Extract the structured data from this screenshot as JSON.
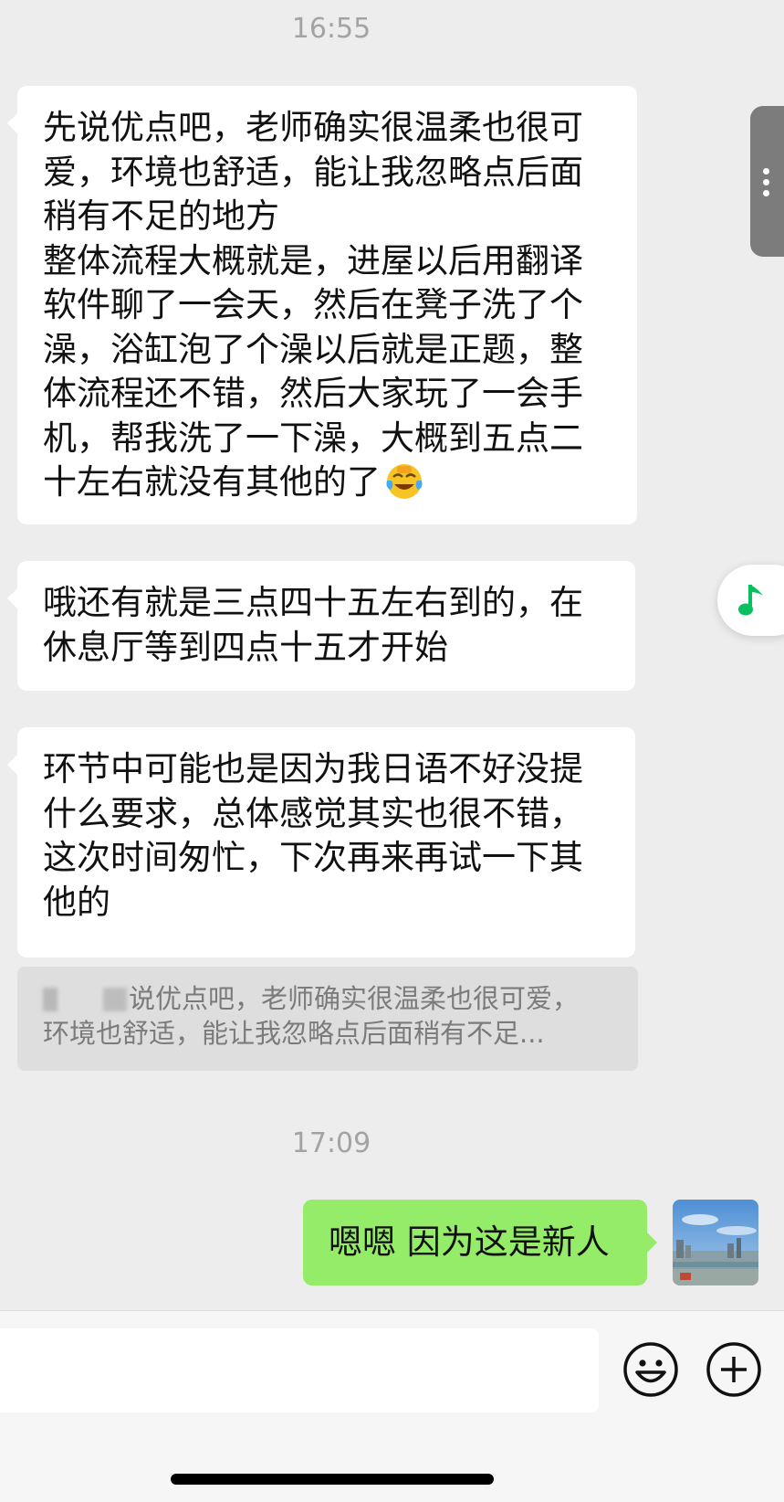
{
  "messages": [
    {
      "type": "time",
      "text": "16:55"
    },
    {
      "type": "incoming",
      "lines": [
        "先说优点吧，老师确实很温柔也很可",
        "爱，环境也舒适，能让我忽略点后面",
        "稍有不足的地方",
        "整体流程大概就是，进屋以后用翻译",
        "软件聊了一会天，然后在凳子洗了个",
        "澡，浴缸泡了个澡以后就是正题，整",
        "体流程还不错，然后大家玩了一会手",
        "机，帮我洗了一下澡，大概到五点二",
        "十左右就没有其他的了"
      ],
      "emoji": "face-with-tears-of-joy"
    },
    {
      "type": "incoming",
      "lines": [
        "哦还有就是三点四十五左右到的，在",
        "休息厅等到四点十五才开始"
      ]
    },
    {
      "type": "incoming",
      "lines": [
        "环节中可能也是因为我日语不好没提",
        "什么要求，总体感觉其实也很不错，",
        "这次时间匆忙，下次再来再试一下其",
        "他的"
      ]
    },
    {
      "type": "quote",
      "lines": [
        "说优点吧，老师确实很温柔也很可爱，",
        "环境也舒适，能让我忽略点后面稍有不足..."
      ]
    },
    {
      "type": "time",
      "text": "17:09"
    },
    {
      "type": "outgoing",
      "text": "嗯嗯 因为这是新人"
    }
  ],
  "icons": {
    "side_handle": "more-dots-icon",
    "floating": "music-note-icon",
    "emoji_button": "smiley-face-icon",
    "more_button": "plus-circle-icon"
  },
  "colors": {
    "background": "#ededed",
    "outgoing_bubble": "#95ec69",
    "incoming_bubble": "#ffffff",
    "music_accent": "#07c160"
  }
}
